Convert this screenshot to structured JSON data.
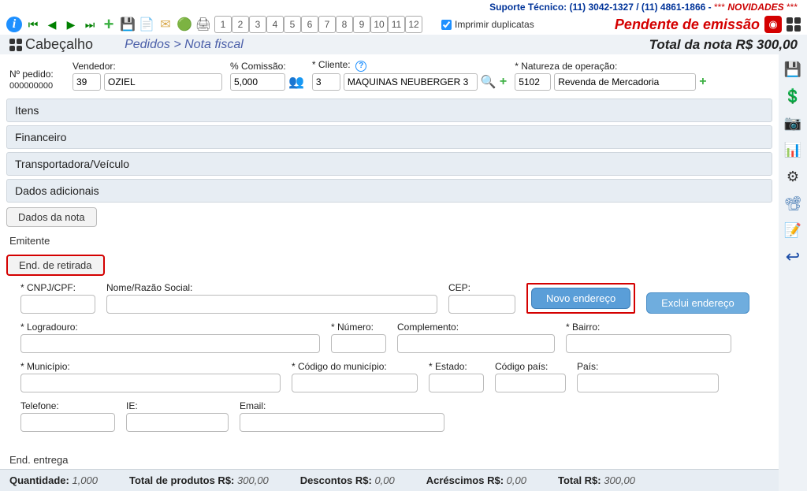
{
  "topbar": {
    "suporte": "Suporte Técnico: (11) 3042-1327 / (11) 4861-1866 - ",
    "stars": "*** ",
    "novidades": "NOVIDADES",
    "stars2": " ***"
  },
  "toolbar": {
    "numbers": [
      "1",
      "2",
      "3",
      "4",
      "5",
      "6",
      "7",
      "8",
      "9",
      "10",
      "11",
      "12"
    ],
    "imprimir": "Imprimir duplicatas",
    "pendente": "Pendente de emissão"
  },
  "breadcrumb": {
    "cabecalho": "Cabeçalho",
    "path": "Pedidos  >  Nota fiscal",
    "total": "Total da nota R$ 300,00"
  },
  "header": {
    "npedido_label": "Nº pedido:",
    "npedido_val": "000000000",
    "vendedor_label": "Vendedor:",
    "vendedor_code": "39",
    "vendedor_name": "OZIEL",
    "comissao_label": "% Comissão:",
    "comissao_val": "5,000",
    "cliente_label": "* Cliente:",
    "cliente_code": "3",
    "cliente_name": "MAQUINAS NEUBERGER 3",
    "natureza_label": "* Natureza de operação:",
    "natureza_code": "5102",
    "natureza_desc": "Revenda de Mercadoria"
  },
  "accordion": {
    "itens": "Itens",
    "financeiro": "Financeiro",
    "transp": "Transportadora/Veículo",
    "dados_adic": "Dados adicionais"
  },
  "tabs": {
    "dados_nota": "Dados da nota",
    "emitente": "Emitente",
    "end_retirada": "End. de retirada",
    "end_entrega": "End. entrega"
  },
  "form": {
    "cnpj": "* CNPJ/CPF:",
    "nome": "Nome/Razão Social:",
    "cep": "CEP:",
    "novo_end": "Novo endereço",
    "exclui_end": "Exclui endereço",
    "logradouro": "* Logradouro:",
    "numero": "* Número:",
    "complemento": "Complemento:",
    "bairro": "* Bairro:",
    "municipio": "* Município:",
    "cod_mun": "* Código do município:",
    "estado": "* Estado:",
    "cod_pais": "Código país:",
    "pais": "País:",
    "telefone": "Telefone:",
    "ie": "IE:",
    "email": "Email:"
  },
  "footer": {
    "qtd_label": "Quantidade:",
    "qtd_val": "1,000",
    "total_prod_label": "Total de produtos R$:",
    "total_prod_val": "300,00",
    "desc_label": "Descontos R$:",
    "desc_val": "0,00",
    "acr_label": "Acréscimos R$:",
    "acr_val": "0,00",
    "total_label": "Total R$:",
    "total_val": "300,00"
  }
}
